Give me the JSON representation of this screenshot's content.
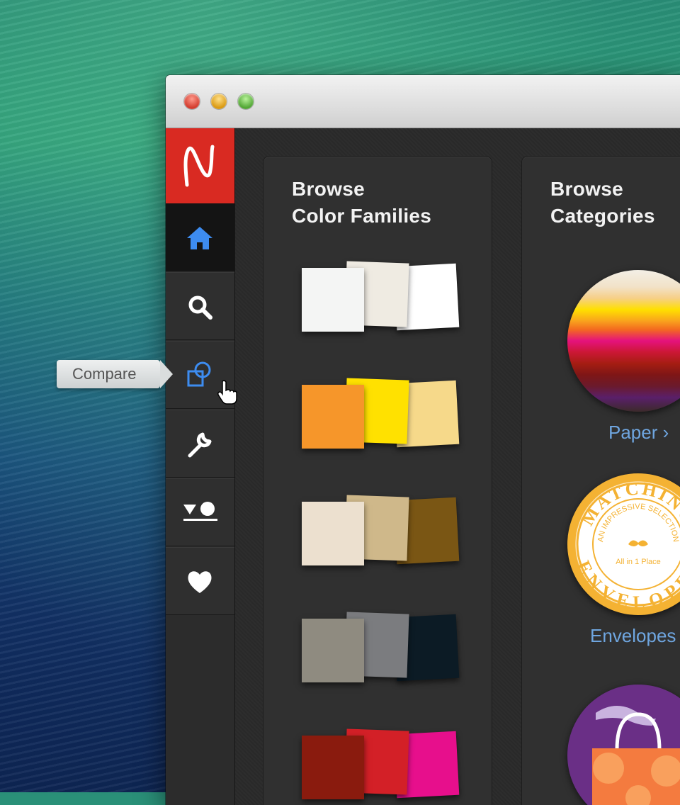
{
  "sidebar": {
    "logo_letter": "N",
    "items": [
      {
        "name": "home",
        "icon": "home-icon",
        "color": "#3d8cf0"
      },
      {
        "name": "search",
        "icon": "search-icon"
      },
      {
        "name": "compare",
        "icon": "compare-icon",
        "color": "#3d8cf0"
      },
      {
        "name": "tools",
        "icon": "wrench-icon"
      },
      {
        "name": "shapes",
        "icon": "shapes-icon"
      },
      {
        "name": "favorites",
        "icon": "heart-icon"
      }
    ]
  },
  "tooltip": {
    "label": "Compare"
  },
  "color_families": {
    "title_line1": "Browse",
    "title_line2": "Color Families",
    "groups": [
      [
        "#f4f5f4",
        "#efebe2",
        "#ffffff"
      ],
      [
        "#f6962a",
        "#ffe100",
        "#f6d98a"
      ],
      [
        "#ece0cf",
        "#cfb88a",
        "#7a5614"
      ],
      [
        "#8f8b80",
        "#7b7c7f",
        "#0c1b25"
      ],
      [
        "#8a1b0e",
        "#d32027",
        "#e70f8c"
      ]
    ]
  },
  "categories": {
    "title_line1": "Browse",
    "title_line2": "Categories",
    "items": [
      {
        "label": "Paper ›"
      },
      {
        "label": "Envelopes ›",
        "badge_top": "MATCHING",
        "badge_bottom": "ENVELOPES",
        "badge_ring": "AN IMPRESSIVE SELECTION",
        "badge_center": "All in 1 Place"
      },
      {
        "label": ""
      }
    ]
  }
}
